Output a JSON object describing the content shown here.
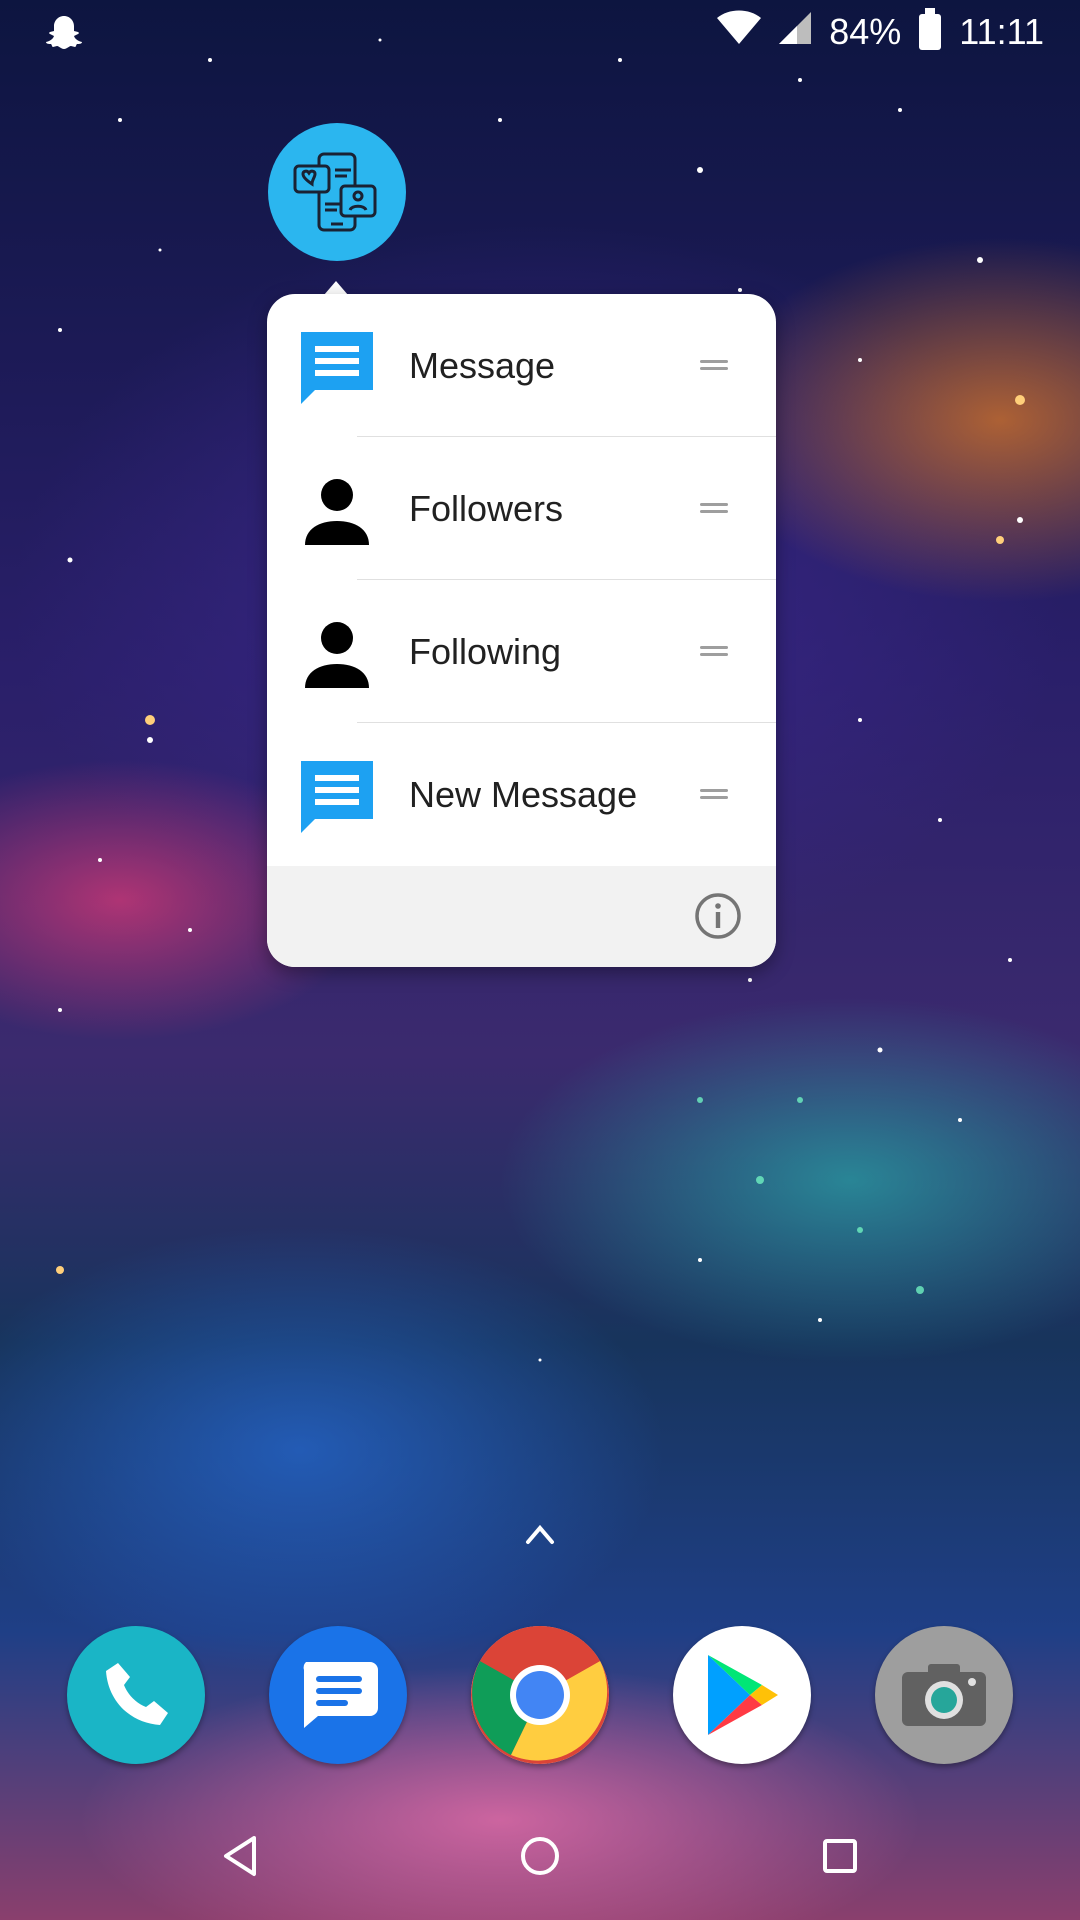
{
  "status_bar": {
    "battery_text": "84%",
    "time": "11:11",
    "icons": [
      "snapchat-ghost-icon",
      "wifi-icon",
      "cell-signal-icon",
      "battery-icon"
    ]
  },
  "app": {
    "icon": "chat-profile-icon"
  },
  "shortcuts": [
    {
      "label": "Message",
      "icon": "message-icon",
      "icon_color": "#1da1f2"
    },
    {
      "label": "Followers",
      "icon": "person-icon",
      "icon_color": "#000000"
    },
    {
      "label": "Following",
      "icon": "person-icon",
      "icon_color": "#000000"
    },
    {
      "label": "New Message",
      "icon": "message-icon",
      "icon_color": "#1da1f2"
    }
  ],
  "dock": [
    {
      "name": "phone",
      "color": "#1ab5c6"
    },
    {
      "name": "messages",
      "color": "#1a73e8"
    },
    {
      "name": "chrome",
      "color": "#ffffff"
    },
    {
      "name": "play-store",
      "color": "#ffffff"
    },
    {
      "name": "camera",
      "color": "#9e9e9e"
    }
  ],
  "nav": [
    "back",
    "home",
    "recents"
  ]
}
